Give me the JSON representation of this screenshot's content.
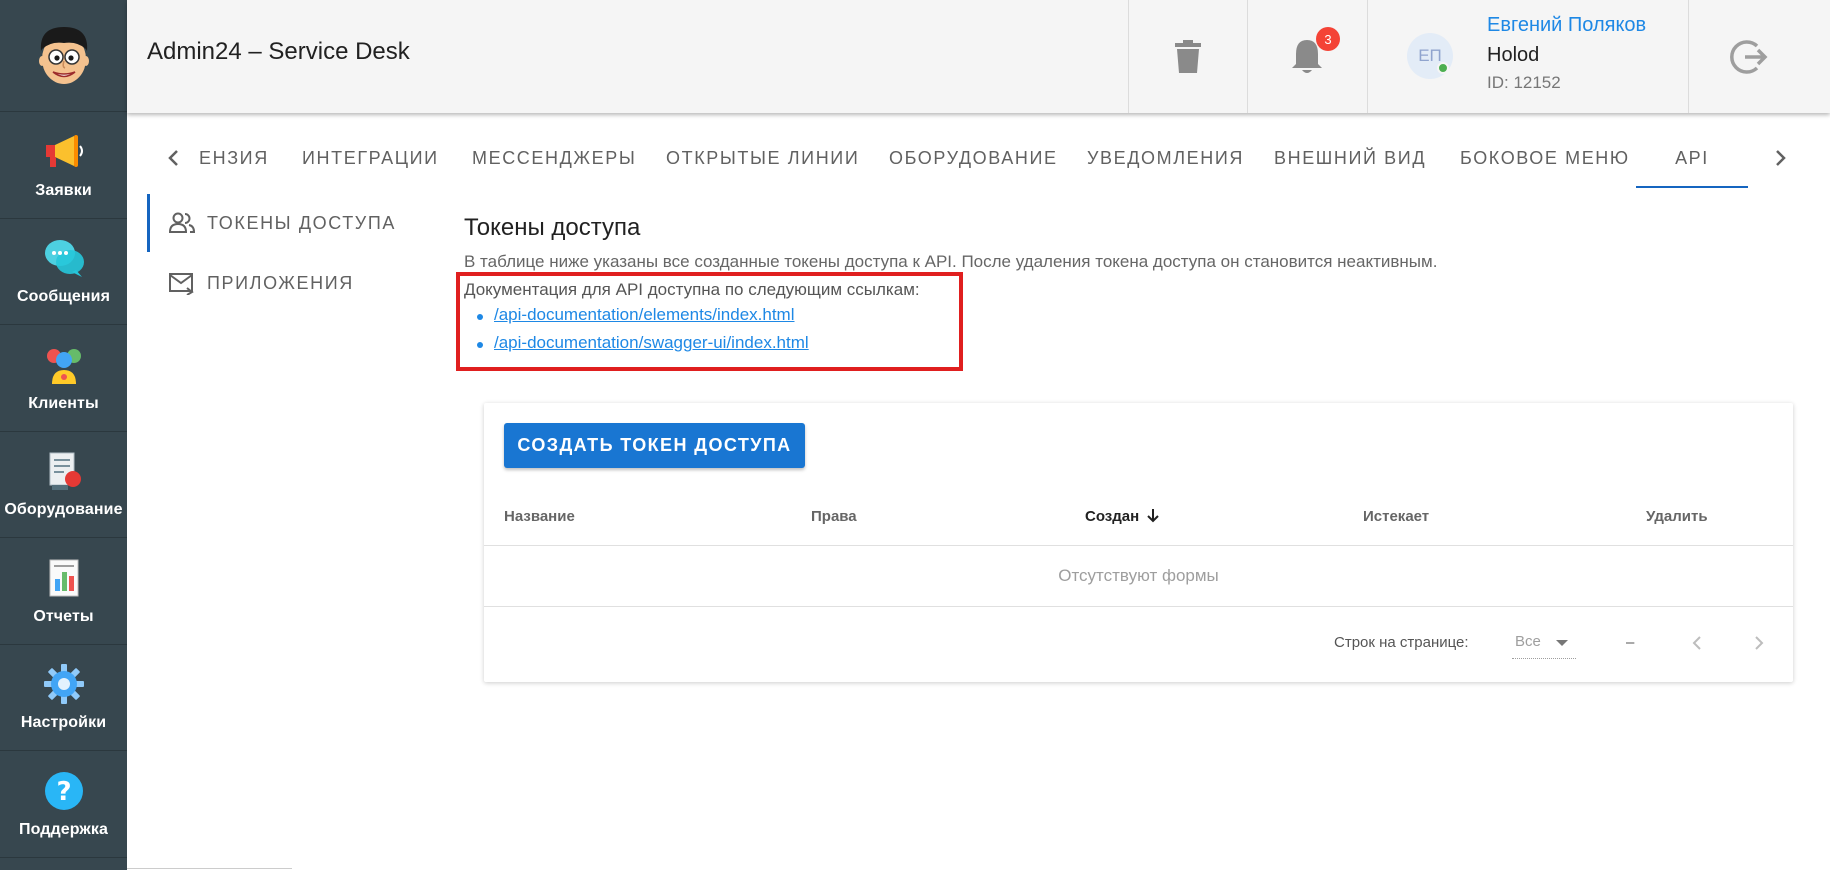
{
  "app": {
    "title": "Admin24 – Service Desk"
  },
  "sidebar": {
    "items": [
      {
        "label": "Заявки",
        "icon": "megaphone-icon"
      },
      {
        "label": "Сообщения",
        "icon": "chat-bubbles-icon"
      },
      {
        "label": "Клиенты",
        "icon": "clients-icon"
      },
      {
        "label": "Оборудование",
        "icon": "equipment-icon"
      },
      {
        "label": "Отчеты",
        "icon": "reports-icon"
      },
      {
        "label": "Настройки",
        "icon": "gear-icon"
      },
      {
        "label": "Поддержка",
        "icon": "help-icon"
      }
    ]
  },
  "header": {
    "notifications_count": "3",
    "user": {
      "initials": "ЕП",
      "name": "Евгений Поляков",
      "org": "Holod",
      "id": "ID: 12152"
    }
  },
  "tabs": {
    "items": [
      "ензия",
      "Интеграции",
      "Мессенджеры",
      "Открытые линии",
      "Оборудование",
      "Уведомления",
      "Внешний вид",
      "Боковое меню",
      "API"
    ],
    "active": "API"
  },
  "subnav": {
    "items": [
      {
        "label": "Токены доступа",
        "icon": "users-icon"
      },
      {
        "label": "Приложения",
        "icon": "mail-icon"
      }
    ]
  },
  "content": {
    "title": "Токены доступа",
    "description": "В таблице ниже указаны все созданные токены доступа к API. После удаления токена доступа он становится неактивным.",
    "doc_text": "Документация для API доступна по следующим ссылкам:",
    "doc_links": [
      "/api-documentation/elements/index.html",
      "/api-documentation/swagger-ui/index.html"
    ]
  },
  "table": {
    "create_button": "СОЗДАТЬ ТОКЕН ДОСТУПА",
    "columns": [
      "Название",
      "Права",
      "Создан",
      "Истекает",
      "Удалить"
    ],
    "sorted_column": "Создан",
    "empty_text": "Отсутствуют формы",
    "rows_per_page_label": "Строк на странице:",
    "rows_per_page_value": "Все",
    "range_text": "–"
  },
  "colors": {
    "sidebar_bg": "#37474f",
    "accent": "#1976d2",
    "link": "#1e88e5",
    "highlight_border": "#e01f1f",
    "badge": "#f44336"
  }
}
